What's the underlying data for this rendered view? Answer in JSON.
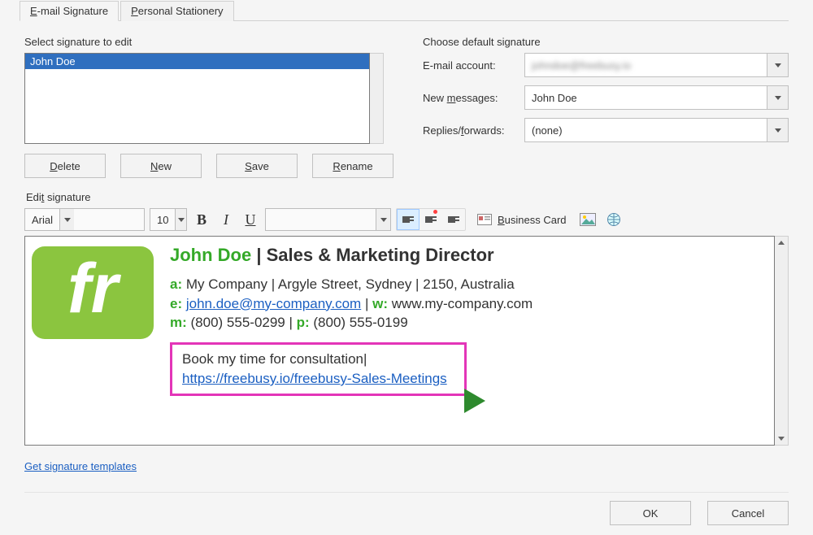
{
  "tabs": {
    "email": "E-mail Signature",
    "stationery": "Personal Stationery"
  },
  "select_label": "Select signature to edit",
  "signature_list": [
    "John Doe"
  ],
  "buttons": {
    "delete": "Delete",
    "new": "New",
    "save": "Save",
    "rename": "Rename",
    "ok": "OK",
    "cancel": "Cancel"
  },
  "defaults": {
    "section_label": "Choose default signature",
    "account_label": "E-mail account:",
    "account_value": "johndoe@freebusy.io",
    "new_msg_label": "New messages:",
    "new_msg_value": "John Doe",
    "reply_label": "Replies/forwards:",
    "reply_value": "(none)"
  },
  "edit_label": "Edit signature",
  "toolbar": {
    "font": "Arial",
    "size": "10",
    "business_card": "Business Card"
  },
  "signature_content": {
    "name": "John Doe",
    "title_sep": " | ",
    "title": "Sales & Marketing Director",
    "addr_label": "a:",
    "addr": " My Company | Argyle Street, Sydney | 2150, Australia",
    "email_label": "e:",
    "email_value": "john.doe@my-company.com",
    "web_sep": " | ",
    "web_label": "w:",
    "web_value": " www.my-company.com",
    "mob_label": "m:",
    "mob_value": " (800) 555-0299 | ",
    "ph_label": "p:",
    "ph_value": " (800) 555-0199",
    "book_text": "Book my time for consultation",
    "book_link": "https://freebusy.io/freebusy-Sales-Meetings"
  },
  "templates_link": "Get signature templates"
}
